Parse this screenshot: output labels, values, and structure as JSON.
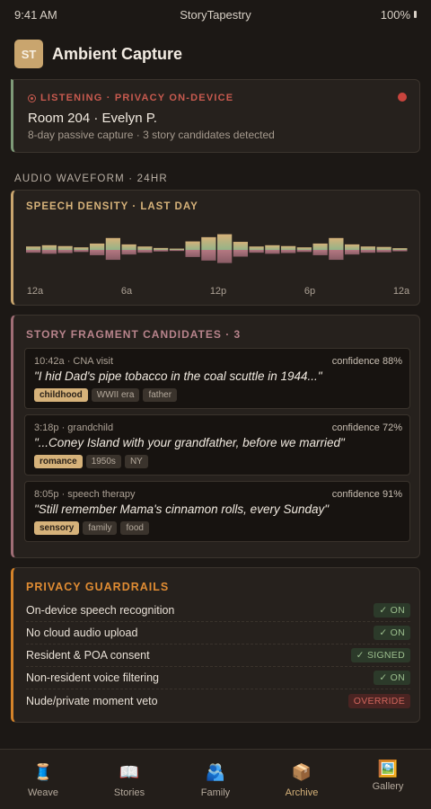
{
  "status": {
    "time": "9:41 AM",
    "app": "StoryTapestry",
    "battery": "100%"
  },
  "header": {
    "avatar": "ST",
    "title": "Ambient Capture"
  },
  "listening": {
    "label": "LISTENING · PRIVACY ON-DEVICE",
    "room": "Room 204 · Evelyn P.",
    "subtitle": "8-day passive capture · 3 story candidates detected"
  },
  "waveform_section": {
    "label": "AUDIO WAVEFORM · 24HR"
  },
  "speech_density": {
    "title": "SPEECH DENSITY · LAST DAY",
    "ticks": [
      "12a",
      "6a",
      "12p",
      "6p",
      "12a"
    ],
    "levels": [
      0.16,
      0.22,
      0.18,
      0.12,
      0.3,
      0.56,
      0.26,
      0.16,
      0.09,
      0.06,
      0.4,
      0.6,
      0.74,
      0.38,
      0.16,
      0.22,
      0.18,
      0.12,
      0.3,
      0.56,
      0.26,
      0.16,
      0.14,
      0.08
    ],
    "colors": {
      "top": "#d6b27a",
      "bottom": "#94b387",
      "negative_top": "#b47882",
      "negative_bottom": "#8a5d66"
    }
  },
  "stories": {
    "title": "STORY FRAGMENT CANDIDATES · 3",
    "items": [
      {
        "meta": "10:42a · CNA visit",
        "confidence": "confidence 88%",
        "quote": "\"I hid Dad's pipe tobacco in the coal scuttle in 1944...\"",
        "tags": [
          "childhood",
          "WWII era",
          "father"
        ]
      },
      {
        "meta": "3:18p · grandchild",
        "confidence": "confidence 72%",
        "quote": "\"...Coney Island with your grandfather, before we married\"",
        "tags": [
          "romance",
          "1950s",
          "NY"
        ]
      },
      {
        "meta": "8:05p · speech therapy",
        "confidence": "confidence 91%",
        "quote": "\"Still remember Mama's cinnamon rolls, every Sunday\"",
        "tags": [
          "sensory",
          "family",
          "food"
        ]
      }
    ]
  },
  "privacy": {
    "title": "PRIVACY GUARDRAILS",
    "rows": [
      {
        "label": "On-device speech recognition",
        "status": "✓ ON"
      },
      {
        "label": "No cloud audio upload",
        "status": "✓ ON"
      },
      {
        "label": "Resident & POA consent",
        "status": "✓ SIGNED"
      },
      {
        "label": "Non-resident voice filtering",
        "status": "✓ ON"
      },
      {
        "label": "Nude/private moment veto",
        "status": "OVERRIDE"
      }
    ]
  },
  "nav": [
    {
      "label": "Weave",
      "icon": "🧵"
    },
    {
      "label": "Stories",
      "icon": "📖"
    },
    {
      "label": "Family",
      "icon": "🫂"
    },
    {
      "label": "Archive",
      "icon": "📦"
    },
    {
      "label": "Gallery",
      "icon": "🖼️"
    }
  ]
}
